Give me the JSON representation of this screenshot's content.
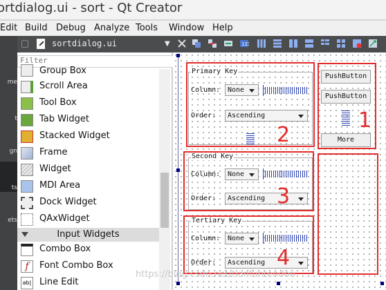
{
  "window": {
    "title": "ortdialog.ui - sort - Qt Creator"
  },
  "menu": [
    "Edit",
    "Build",
    "Debug",
    "Analyze",
    "Tools",
    "Window",
    "Help"
  ],
  "mode_labels": [
    "me",
    "t",
    "gn",
    "ts",
    "ets"
  ],
  "editor": {
    "file_name": "sortdialog.ui"
  },
  "widget_box": {
    "filter_placeholder": "Filter",
    "items": [
      "Group Box",
      "Scroll Area",
      "Tool Box",
      "Tab Widget",
      "Stacked Widget",
      "Frame",
      "Widget",
      "MDI Area",
      "Dock Widget",
      "QAxWidget"
    ],
    "category": "Input Widgets",
    "input_items": [
      "Combo Box",
      "Font Combo Box",
      "Line Edit"
    ]
  },
  "form": {
    "primary": {
      "title": "Primary Key",
      "column_label": "Column:",
      "column_value": "None",
      "order_label": "Order:",
      "order_value": "Ascending"
    },
    "secondary": {
      "title": "Second Key",
      "column_label": "Column:",
      "column_value": "None",
      "order_label": "Order:",
      "order_value": "Ascending"
    },
    "tertiary": {
      "title": "Tertiary Key",
      "column_label": "Column:",
      "column_value": "None",
      "order_label": "Order:",
      "order_value": "Ascending"
    },
    "buttons": {
      "button1": "PushButton",
      "button2": "PushButton",
      "more": "More"
    }
  },
  "annotations": {
    "n1": "1",
    "n2": "2",
    "n3": "3",
    "n4": "4",
    "accent": "#e32b2b"
  },
  "watermark": "https://blog.csdn.net/tianfuntendou"
}
